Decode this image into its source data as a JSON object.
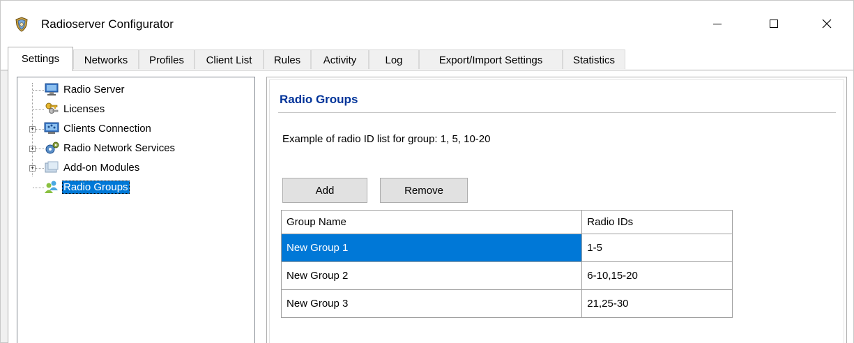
{
  "window": {
    "title": "Radioserver Configurator"
  },
  "tabs": [
    {
      "label": "Settings",
      "active": true
    },
    {
      "label": "Networks",
      "active": false
    },
    {
      "label": "Profiles",
      "active": false
    },
    {
      "label": "Client List",
      "active": false
    },
    {
      "label": "Rules",
      "active": false
    },
    {
      "label": "Activity",
      "active": false
    },
    {
      "label": "Log",
      "active": false
    },
    {
      "label": "Export/Import Settings",
      "active": false
    },
    {
      "label": "Statistics",
      "active": false
    }
  ],
  "tree": {
    "items": [
      {
        "label": "Radio Server",
        "icon": "server-icon",
        "expandable": false
      },
      {
        "label": "Licenses",
        "icon": "keys-icon",
        "expandable": false
      },
      {
        "label": "Clients Connection",
        "icon": "network-icon",
        "expandable": true
      },
      {
        "label": "Radio Network Services",
        "icon": "services-gear-icon",
        "expandable": true
      },
      {
        "label": "Add-on Modules",
        "icon": "modules-icon",
        "expandable": true
      },
      {
        "label": "Radio Groups",
        "icon": "users-group-icon",
        "expandable": false,
        "selected": true
      }
    ]
  },
  "panel": {
    "title": "Radio Groups",
    "example": "Example of radio ID list for group: 1, 5, 10-20",
    "add_label": "Add",
    "remove_label": "Remove"
  },
  "grid": {
    "columns": [
      "Group Name",
      "Radio IDs"
    ],
    "rows": [
      {
        "name": "New Group 1",
        "ids": "1-5",
        "selected": true
      },
      {
        "name": "New Group 2",
        "ids": "6-10,15-20",
        "selected": false
      },
      {
        "name": "New Group 3",
        "ids": "21,25-30",
        "selected": false
      }
    ]
  },
  "colors": {
    "selection": "#0078d7",
    "panel_title": "#003399"
  }
}
